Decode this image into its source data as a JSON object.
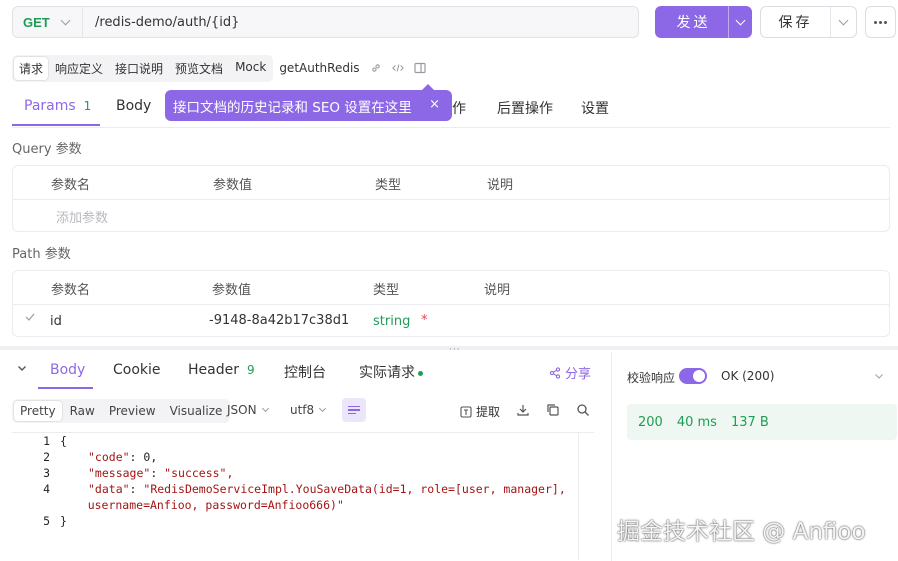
{
  "request": {
    "method": "GET",
    "url": "/redis-demo/auth/{id}",
    "send_label": "发送",
    "save_label": "保存"
  },
  "doc_tabs": [
    "请求",
    "响应定义",
    "接口说明",
    "预览文档",
    "Mock"
  ],
  "doc_name": "getAuthRedis",
  "req_tabs": {
    "params": "Params",
    "params_count": "1",
    "body": "Body",
    "pre_partial": "作",
    "post": "后置操作",
    "settings": "设置"
  },
  "tooltip": {
    "text": "接口文档的历史记录和 SEO 设置在这里",
    "close": "×"
  },
  "query": {
    "title": "Query 参数",
    "headers": [
      "参数名",
      "参数值",
      "类型",
      "说明"
    ],
    "add_placeholder": "添加参数"
  },
  "path": {
    "title": "Path 参数",
    "headers": [
      "参数名",
      "参数值",
      "类型",
      "说明"
    ],
    "row": {
      "name": "id",
      "value": "-9148-8a42b17c38d1",
      "type": "string",
      "required": "*"
    }
  },
  "response": {
    "tabs": {
      "body": "Body",
      "cookie": "Cookie",
      "header": "Header",
      "header_count": "9",
      "console": "控制台",
      "actual": "实际请求"
    },
    "share": "分享",
    "formats": [
      "Pretty",
      "Raw",
      "Preview",
      "Visualize"
    ],
    "format_select": "JSON",
    "encoding_select": "utf8",
    "extract": "提取",
    "code_lines": [
      {
        "no": "1",
        "text": "{"
      },
      {
        "no": "2",
        "key": "\"code\"",
        "val": " 0,"
      },
      {
        "no": "3",
        "key": "\"message\"",
        "val": " \"success\","
      },
      {
        "no": "4",
        "key": "\"data\"",
        "val": " \"RedisDemoServiceImpl.YouSaveData(id=1, role=[user, manager],"
      },
      {
        "no": "",
        "text": "    username=Anfioo, password=Anfioo666)\""
      },
      {
        "no": "5",
        "text": "}"
      }
    ]
  },
  "result": {
    "validate_label": "校验响应",
    "status_text": "OK (200)",
    "status_code": "200",
    "time": "40 ms",
    "size": "137 B"
  },
  "watermark": "掘金技术社区 @ Anfioo",
  "colors": {
    "accent": "#8d68e6",
    "success": "#1f9d55",
    "string": "#a31515"
  }
}
